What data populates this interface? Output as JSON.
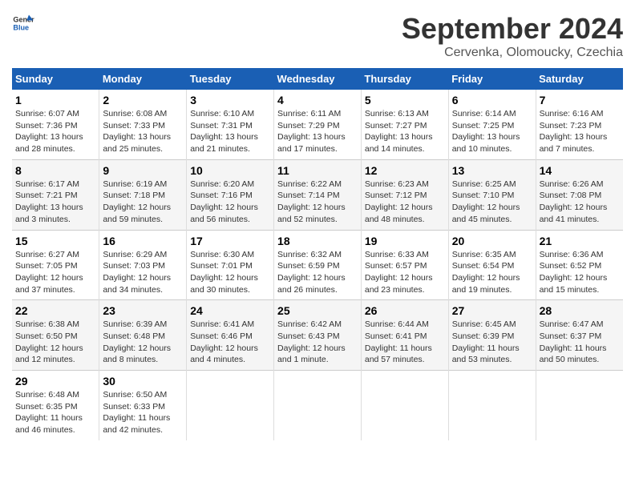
{
  "header": {
    "logo_line1": "General",
    "logo_line2": "Blue",
    "title": "September 2024",
    "subtitle": "Cervenka, Olomoucky, Czechia"
  },
  "columns": [
    "Sunday",
    "Monday",
    "Tuesday",
    "Wednesday",
    "Thursday",
    "Friday",
    "Saturday"
  ],
  "weeks": [
    [
      {
        "day": "1",
        "info": "Sunrise: 6:07 AM\nSunset: 7:36 PM\nDaylight: 13 hours\nand 28 minutes."
      },
      {
        "day": "2",
        "info": "Sunrise: 6:08 AM\nSunset: 7:33 PM\nDaylight: 13 hours\nand 25 minutes."
      },
      {
        "day": "3",
        "info": "Sunrise: 6:10 AM\nSunset: 7:31 PM\nDaylight: 13 hours\nand 21 minutes."
      },
      {
        "day": "4",
        "info": "Sunrise: 6:11 AM\nSunset: 7:29 PM\nDaylight: 13 hours\nand 17 minutes."
      },
      {
        "day": "5",
        "info": "Sunrise: 6:13 AM\nSunset: 7:27 PM\nDaylight: 13 hours\nand 14 minutes."
      },
      {
        "day": "6",
        "info": "Sunrise: 6:14 AM\nSunset: 7:25 PM\nDaylight: 13 hours\nand 10 minutes."
      },
      {
        "day": "7",
        "info": "Sunrise: 6:16 AM\nSunset: 7:23 PM\nDaylight: 13 hours\nand 7 minutes."
      }
    ],
    [
      {
        "day": "8",
        "info": "Sunrise: 6:17 AM\nSunset: 7:21 PM\nDaylight: 13 hours\nand 3 minutes."
      },
      {
        "day": "9",
        "info": "Sunrise: 6:19 AM\nSunset: 7:18 PM\nDaylight: 12 hours\nand 59 minutes."
      },
      {
        "day": "10",
        "info": "Sunrise: 6:20 AM\nSunset: 7:16 PM\nDaylight: 12 hours\nand 56 minutes."
      },
      {
        "day": "11",
        "info": "Sunrise: 6:22 AM\nSunset: 7:14 PM\nDaylight: 12 hours\nand 52 minutes."
      },
      {
        "day": "12",
        "info": "Sunrise: 6:23 AM\nSunset: 7:12 PM\nDaylight: 12 hours\nand 48 minutes."
      },
      {
        "day": "13",
        "info": "Sunrise: 6:25 AM\nSunset: 7:10 PM\nDaylight: 12 hours\nand 45 minutes."
      },
      {
        "day": "14",
        "info": "Sunrise: 6:26 AM\nSunset: 7:08 PM\nDaylight: 12 hours\nand 41 minutes."
      }
    ],
    [
      {
        "day": "15",
        "info": "Sunrise: 6:27 AM\nSunset: 7:05 PM\nDaylight: 12 hours\nand 37 minutes."
      },
      {
        "day": "16",
        "info": "Sunrise: 6:29 AM\nSunset: 7:03 PM\nDaylight: 12 hours\nand 34 minutes."
      },
      {
        "day": "17",
        "info": "Sunrise: 6:30 AM\nSunset: 7:01 PM\nDaylight: 12 hours\nand 30 minutes."
      },
      {
        "day": "18",
        "info": "Sunrise: 6:32 AM\nSunset: 6:59 PM\nDaylight: 12 hours\nand 26 minutes."
      },
      {
        "day": "19",
        "info": "Sunrise: 6:33 AM\nSunset: 6:57 PM\nDaylight: 12 hours\nand 23 minutes."
      },
      {
        "day": "20",
        "info": "Sunrise: 6:35 AM\nSunset: 6:54 PM\nDaylight: 12 hours\nand 19 minutes."
      },
      {
        "day": "21",
        "info": "Sunrise: 6:36 AM\nSunset: 6:52 PM\nDaylight: 12 hours\nand 15 minutes."
      }
    ],
    [
      {
        "day": "22",
        "info": "Sunrise: 6:38 AM\nSunset: 6:50 PM\nDaylight: 12 hours\nand 12 minutes."
      },
      {
        "day": "23",
        "info": "Sunrise: 6:39 AM\nSunset: 6:48 PM\nDaylight: 12 hours\nand 8 minutes."
      },
      {
        "day": "24",
        "info": "Sunrise: 6:41 AM\nSunset: 6:46 PM\nDaylight: 12 hours\nand 4 minutes."
      },
      {
        "day": "25",
        "info": "Sunrise: 6:42 AM\nSunset: 6:43 PM\nDaylight: 12 hours\nand 1 minute."
      },
      {
        "day": "26",
        "info": "Sunrise: 6:44 AM\nSunset: 6:41 PM\nDaylight: 11 hours\nand 57 minutes."
      },
      {
        "day": "27",
        "info": "Sunrise: 6:45 AM\nSunset: 6:39 PM\nDaylight: 11 hours\nand 53 minutes."
      },
      {
        "day": "28",
        "info": "Sunrise: 6:47 AM\nSunset: 6:37 PM\nDaylight: 11 hours\nand 50 minutes."
      }
    ],
    [
      {
        "day": "29",
        "info": "Sunrise: 6:48 AM\nSunset: 6:35 PM\nDaylight: 11 hours\nand 46 minutes."
      },
      {
        "day": "30",
        "info": "Sunrise: 6:50 AM\nSunset: 6:33 PM\nDaylight: 11 hours\nand 42 minutes."
      },
      {
        "day": "",
        "info": ""
      },
      {
        "day": "",
        "info": ""
      },
      {
        "day": "",
        "info": ""
      },
      {
        "day": "",
        "info": ""
      },
      {
        "day": "",
        "info": ""
      }
    ]
  ]
}
